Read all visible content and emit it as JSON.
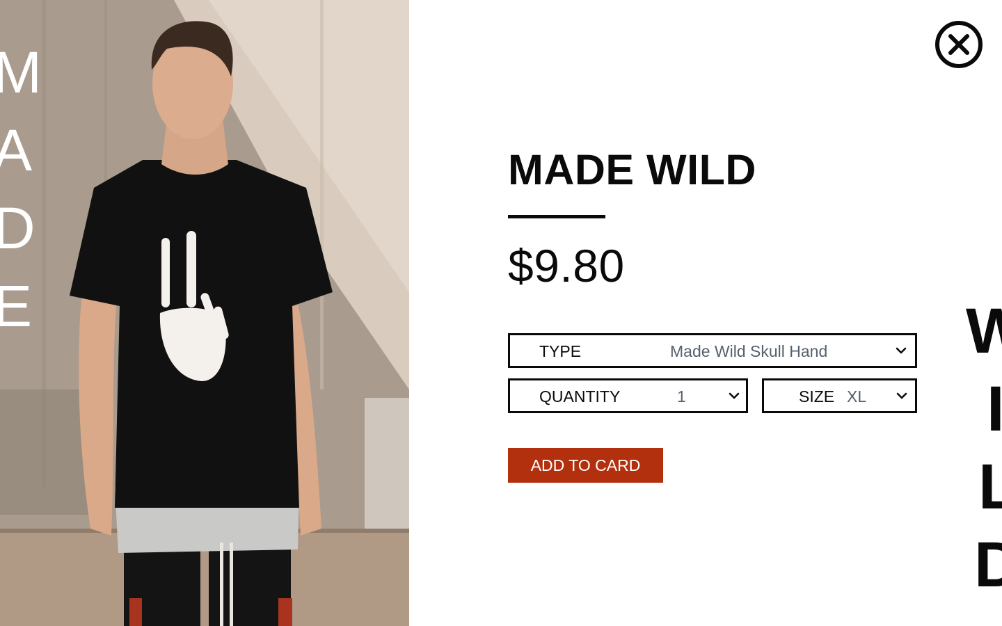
{
  "hero": {
    "vertical_word_letters": [
      "M",
      "A",
      "D",
      "E"
    ],
    "photo_description_icon": "model-photo"
  },
  "close": {
    "icon": "close-circle-icon"
  },
  "product": {
    "title": "MADE WILD",
    "price": "$9.80"
  },
  "options": {
    "type": {
      "label": "TYPE",
      "value": "Made Wild Skull Hand"
    },
    "quantity": {
      "label": "QUANTITY",
      "value": "1"
    },
    "size": {
      "label": "SIZE",
      "value": "XL"
    }
  },
  "cart": {
    "button_label": "ADD TO CARD"
  },
  "side_word": {
    "letters": [
      "W",
      "I",
      "L",
      "D"
    ]
  },
  "colors": {
    "accent": "#b3300f",
    "text": "#0a0a0a",
    "muted_value": "#56606e",
    "background": "#ffffff"
  }
}
